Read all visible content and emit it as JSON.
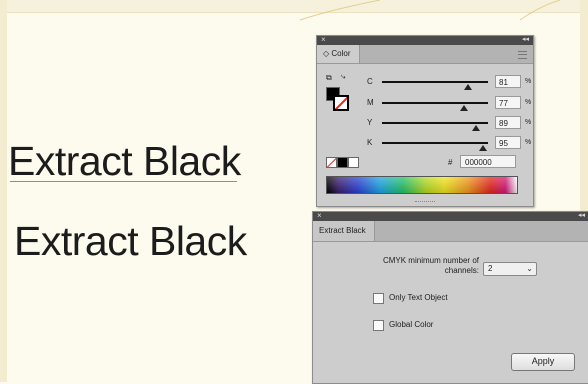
{
  "headings": {
    "line1": "Extract Black",
    "line2": "Extract Black"
  },
  "color_panel": {
    "close_glyph": "×",
    "collapse_glyph": "◂◂",
    "tab_label": "Color",
    "default_colors_icon": "default-fill-stroke-icon",
    "swap_icon": "swap-fill-stroke-icon",
    "channels": [
      {
        "label": "C",
        "value": "81",
        "unit": "%",
        "level": 0.81
      },
      {
        "label": "M",
        "value": "77",
        "unit": "%",
        "level": 0.77
      },
      {
        "label": "Y",
        "value": "89",
        "unit": "%",
        "level": 0.89
      },
      {
        "label": "K",
        "value": "95",
        "unit": "%",
        "level": 0.95
      }
    ],
    "hex_prefix": "#",
    "hex_value": "000000"
  },
  "extract_panel": {
    "close_glyph": "×",
    "collapse_glyph": "◂◂",
    "tab_label": "Extract Black",
    "field_label": "CMYK minimum number of channels:",
    "select_value": "2",
    "only_text_label": "Only Text Object",
    "only_text_checked": false,
    "global_color_label": "Global Color",
    "global_color_checked": false,
    "apply_label": "Apply"
  }
}
